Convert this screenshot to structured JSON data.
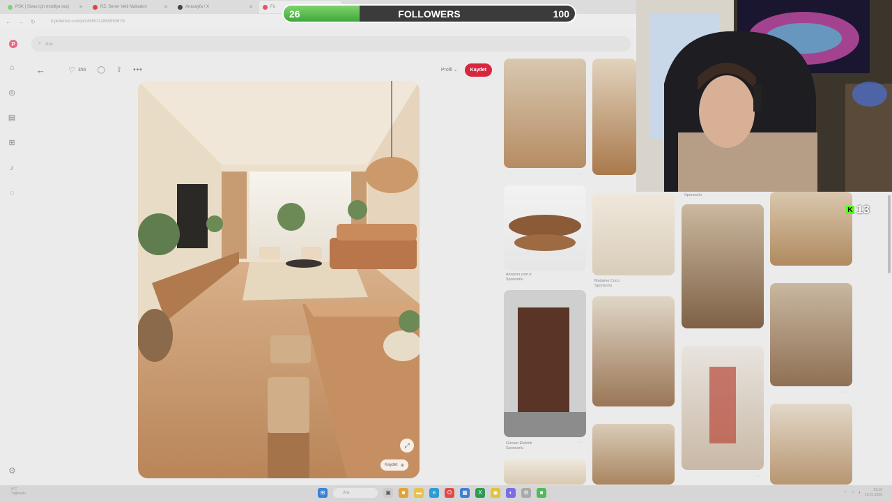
{
  "browser": {
    "tabs": [
      {
        "label": "PSK | Sivas için mobilya seçi",
        "color": "#7ad47a"
      },
      {
        "label": "RZ: Sener Vetli Makadon",
        "color": "#e04444"
      },
      {
        "label": "Anasayfa / X",
        "color": "#444444"
      },
      {
        "label": "Fo",
        "color": "#e0556a"
      }
    ],
    "url": "tr.pinterest.com/pin/4850112880893670/"
  },
  "pinterest": {
    "logo": "P",
    "search_placeholder": "Ara",
    "nav_icons": [
      "home-icon",
      "compass-icon",
      "dashboard-icon",
      "plus-square-icon",
      "bell-icon",
      "chat-icon"
    ],
    "toolbar": {
      "likes": "356",
      "profile_label": "Profil",
      "save_label": "Kaydet"
    },
    "pin_save_label": "Kaydet",
    "captions": [
      {
        "title": "Amazon.com.tr",
        "sub": "Sponsorlu"
      },
      {
        "title": "Madame Coco",
        "sub": "Sponsorlu"
      },
      {
        "title": "Gürsan Elektrik",
        "sub": "Sponsorlu"
      },
      {
        "title": "",
        "sub": "Sponsorlu"
      }
    ]
  },
  "overlay": {
    "followers_label": "FOLLOWERS",
    "current": "26",
    "goal": "100",
    "progress": 0.26,
    "kick_count": "13",
    "kick_letter": "K",
    "accent_green": "#53fc18"
  },
  "taskbar": {
    "weather_temp": "9°C",
    "weather_desc": "Yağmurlu",
    "search_label": "Ara",
    "time": "23:10",
    "date": "15.01.2026"
  }
}
